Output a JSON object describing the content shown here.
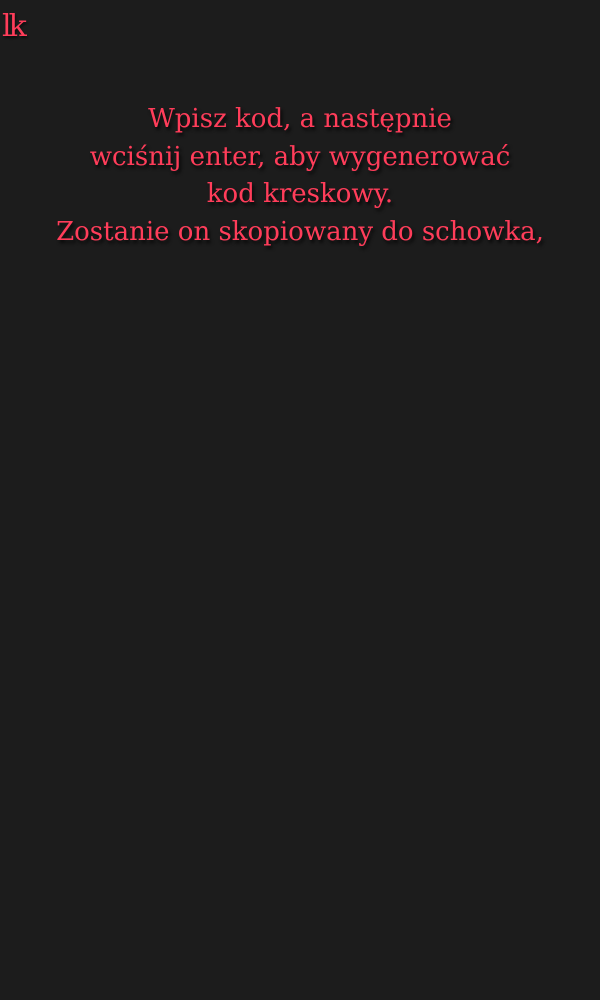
{
  "logo": {
    "text": "lk",
    "color": "#ff3d5a"
  },
  "instructions": {
    "lines": [
      "Wpisz kod, a następnie",
      "wciśnij enter, aby wygenerować",
      "kod kreskowy.",
      "Zostanie on skopiowany do schowka,"
    ],
    "color": "#ff3d5a"
  },
  "background_color": "#1c1c1c"
}
